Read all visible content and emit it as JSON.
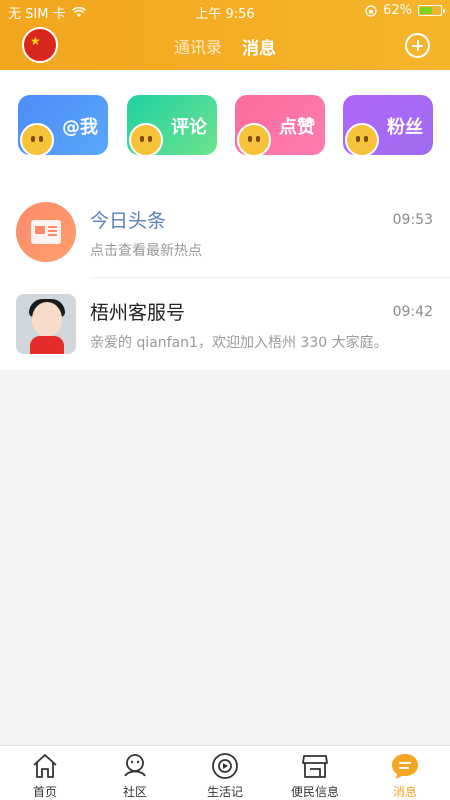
{
  "status_bar": {
    "carrier": "无 SIM 卡",
    "time": "上午 9:56",
    "battery": "62%",
    "battery_level": 0.62
  },
  "header": {
    "tabs": [
      {
        "label": "通讯录"
      },
      {
        "label": "消息"
      }
    ],
    "active_tab": 1,
    "add_icon": "plus-circle-icon",
    "avatar_icon": "china-flag-icon"
  },
  "quick_actions": [
    {
      "label": "@我",
      "color": "#4a8df8"
    },
    {
      "label": "评论",
      "color": "#1fd1a3"
    },
    {
      "label": "点赞",
      "color": "#fc6c9a"
    },
    {
      "label": "粉丝",
      "color": "#b066f7"
    }
  ],
  "messages": [
    {
      "title": "今日头条",
      "time": "09:53",
      "preview": "点击查看最新热点",
      "icon": "newspaper-icon"
    },
    {
      "title": "梧州客服号",
      "time": "09:42",
      "preview": "亲爱的 qianfan1，欢迎加入梧州 330 大家庭。",
      "icon": "customer-service-avatar"
    }
  ],
  "tabbar": [
    {
      "label": "首页",
      "icon": "home-icon"
    },
    {
      "label": "社区",
      "icon": "community-icon"
    },
    {
      "label": "生活记",
      "icon": "life-journal-icon"
    },
    {
      "label": "便民信息",
      "icon": "store-icon"
    },
    {
      "label": "消息",
      "icon": "message-icon",
      "active": true
    }
  ],
  "colors": {
    "accent": "#f5a623",
    "header": "#f2a61e"
  }
}
